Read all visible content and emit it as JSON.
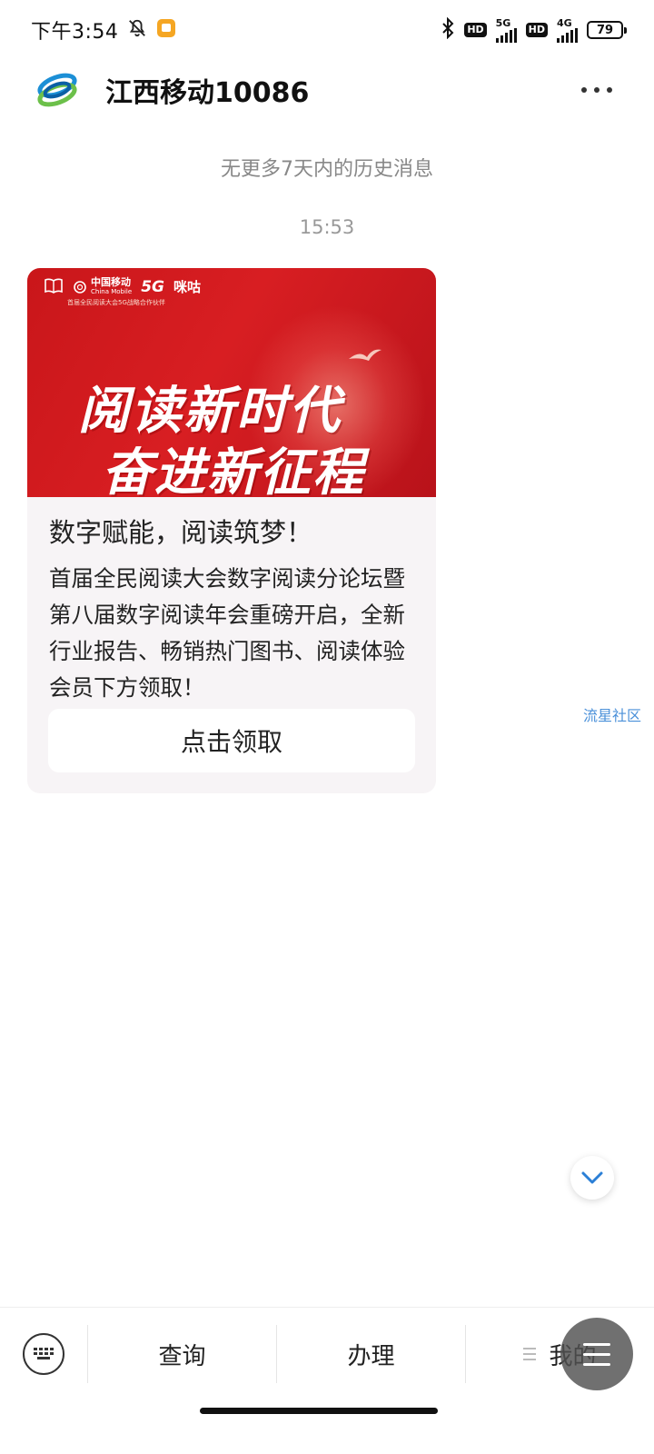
{
  "status_bar": {
    "time": "下午3:54",
    "network1": "5G",
    "network2": "4G",
    "hd_label": "HD",
    "battery": "79"
  },
  "header": {
    "title": "江西移动10086"
  },
  "history_note": "无更多7天内的历史消息",
  "timestamp": "15:53",
  "card": {
    "banner": {
      "logo_cmcc": "中国移动",
      "logo_cmcc_en": "China Mobile",
      "logo_5g": "5G",
      "logo_migu": "咪咕",
      "subline": "首届全民阅读大会5G战略合作伙伴",
      "headline_1": "阅读新时代",
      "headline_2": "奋进新征程"
    },
    "title": "数字赋能，阅读筑梦！",
    "body": "首届全民阅读大会数字阅读分论坛暨第八届数字阅读年会重磅开启，全新行业报告、畅销热门图书、阅读体验会员下方领取！",
    "button_label": "点击领取"
  },
  "watermark": "流星社区",
  "bottom_menu": {
    "items": [
      {
        "label": "查询"
      },
      {
        "label": "办理"
      },
      {
        "label": "我的"
      }
    ]
  },
  "colors": {
    "banner_red": "#d81e22",
    "watermark_blue": "#4a90d9",
    "chevron_blue": "#2b7fd6"
  }
}
